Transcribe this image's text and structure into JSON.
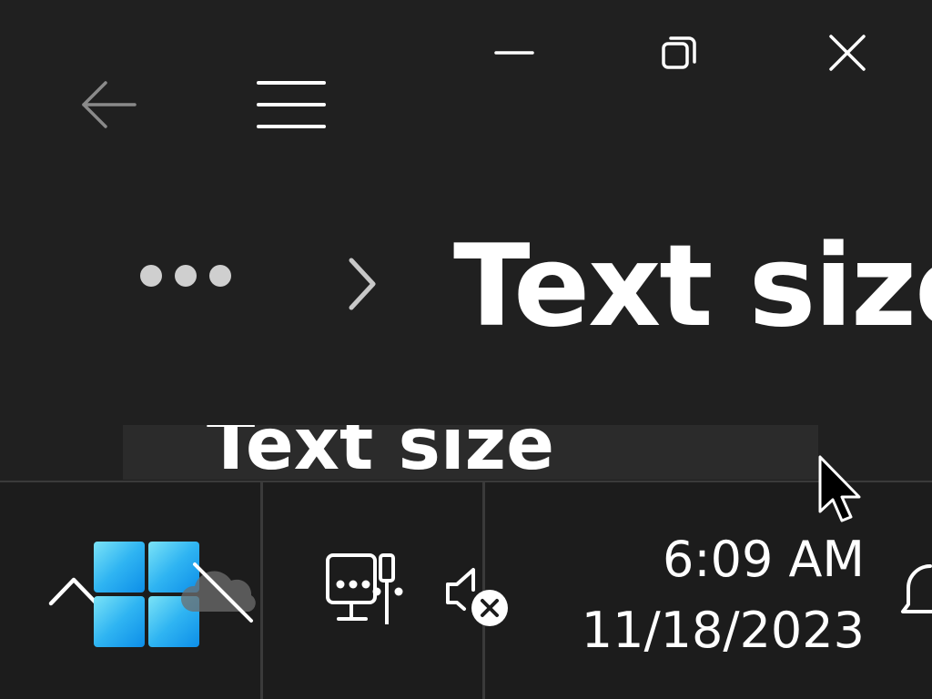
{
  "window": {
    "controls": {
      "minimize_icon": "minimize-icon",
      "restore_icon": "restore-icon",
      "close_icon": "close-icon"
    }
  },
  "app": {
    "back_icon": "back-arrow-icon",
    "menu_icon": "hamburger-menu-icon"
  },
  "breadcrumb": {
    "more_icon": "more-dots-icon",
    "separator_icon": "chevron-right-icon",
    "current": "Text size"
  },
  "preview": {
    "text": "Text size"
  },
  "taskbar": {
    "overflow_icon": "chevron-up-icon",
    "start_icon": "windows-logo-icon",
    "tray_icons": [
      "onedrive-icon",
      "network-icon",
      "volume-muted-icon",
      "notification-bell-icon"
    ],
    "clock": {
      "time": "6:09 AM",
      "date": "11/18/2023"
    }
  },
  "colors": {
    "background": "#202020",
    "taskbar": "#1c1c1c",
    "preview_strip": "#2b2b2b",
    "windows_logo": "#27a6ef"
  }
}
